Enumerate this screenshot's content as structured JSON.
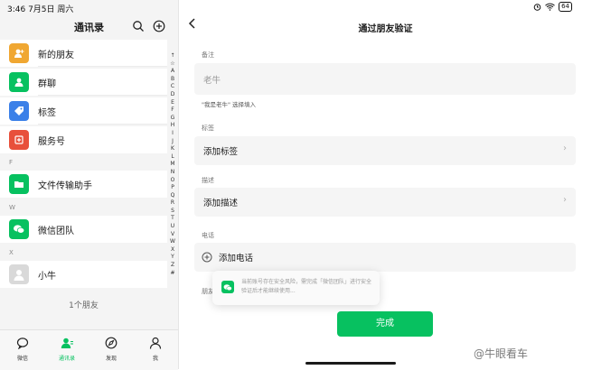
{
  "status_bar": {
    "time": "3:46 7月5日 周六",
    "battery": "64"
  },
  "contacts": {
    "title": "通讯录",
    "items": [
      {
        "label": "新的朋友",
        "icon": "add-friend-icon",
        "color": "#f0a732"
      },
      {
        "label": "群聊",
        "icon": "group-icon",
        "color": "#07c160"
      },
      {
        "label": "标签",
        "icon": "tag-icon",
        "color": "#3b80e8"
      },
      {
        "label": "服务号",
        "icon": "service-account-icon",
        "color": "#e8503b"
      }
    ],
    "sections": [
      {
        "letter": "F",
        "contact": "文件传输助手",
        "icon": "folder-icon",
        "color": "#07c160"
      },
      {
        "letter": "W",
        "contact": "微信团队",
        "icon": "wechat-team-icon",
        "color": "#07c160"
      },
      {
        "letter": "X",
        "contact": "小牛",
        "icon": "avatar-icon",
        "color": "#d9d9d9"
      }
    ],
    "index": [
      "↑",
      "☆",
      "A",
      "B",
      "C",
      "D",
      "E",
      "F",
      "G",
      "H",
      "I",
      "J",
      "K",
      "L",
      "M",
      "N",
      "O",
      "P",
      "Q",
      "R",
      "S",
      "T",
      "U",
      "V",
      "W",
      "X",
      "Y",
      "Z",
      "#"
    ],
    "count": "1个朋友"
  },
  "tabbar": [
    {
      "label": "微信",
      "icon": "chat-icon"
    },
    {
      "label": "通讯录",
      "icon": "contacts-icon",
      "active": true
    },
    {
      "label": "发现",
      "icon": "discover-icon"
    },
    {
      "label": "我",
      "icon": "me-icon"
    }
  ],
  "verify": {
    "title": "通过朋友验证",
    "remark_label": "备注",
    "remark_value": "老牛",
    "remark_hint": "\"我是老牛\" 选择填入",
    "tags_label": "标签",
    "tags_action": "添加标签",
    "desc_label": "描述",
    "desc_action": "添加描述",
    "phone_label": "电话",
    "phone_action": "添加电话",
    "hidden_label": "朋友",
    "toast": "当前账号存在安全风险，需完成「微信团队」进行安全验证后才能继续使用...",
    "done": "完成"
  },
  "watermark": "@牛眼看车",
  "colors": {
    "accent": "#07c160"
  }
}
